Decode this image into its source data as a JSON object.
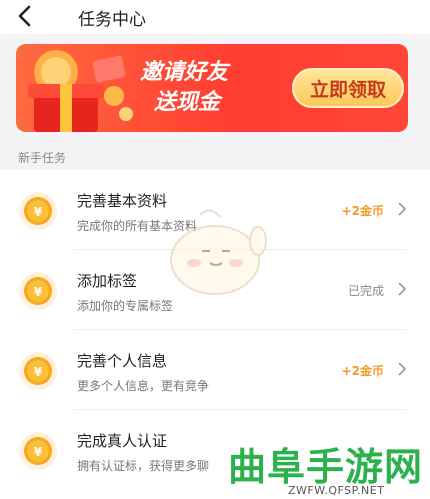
{
  "header": {
    "title": "任务中心",
    "back_icon": "chevron-left-icon"
  },
  "banner": {
    "line1": "邀请好友",
    "line2": "送现金",
    "button_label": "立即领取",
    "gift_icon": "gift-box-icon"
  },
  "section": {
    "label": "新手任务"
  },
  "tasks": [
    {
      "title": "完善基本资料",
      "subtitle": "完成你的所有基本资料",
      "status": "+2金币",
      "status_type": "reward",
      "icon": "coin-icon"
    },
    {
      "title": "添加标签",
      "subtitle": "添加你的专属标签",
      "status": "已完成",
      "status_type": "done",
      "icon": "coin-icon"
    },
    {
      "title": "完善个人信息",
      "subtitle": "更多个人信息，更有竞争",
      "status": "+2金币",
      "status_type": "reward",
      "icon": "coin-icon"
    },
    {
      "title": "完成真人认证",
      "subtitle": "拥有认证标，获得更多聊",
      "status": "",
      "status_type": "",
      "icon": "coin-icon"
    }
  ],
  "watermark": {
    "text": "曲阜手游网",
    "url": "ZWFW.QFSP.NET"
  },
  "colors": {
    "accent": "#f39a23",
    "banner": "#ff3d31",
    "watermark": "#2bb24c"
  }
}
